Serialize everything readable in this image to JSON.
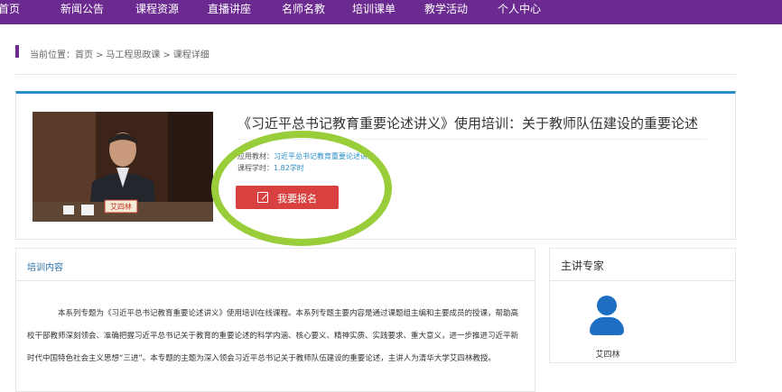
{
  "nav": {
    "items": [
      "首页",
      "新闻公告",
      "课程资源",
      "直播讲座",
      "名师名教",
      "培训课单",
      "教学活动",
      "个人中心"
    ]
  },
  "breadcrumb": {
    "prefix": "当前位置：",
    "items": [
      "首页",
      "马工程思政课",
      "课程详细"
    ],
    "separator": ">"
  },
  "course": {
    "title": "《习近平总书记教育重要论述讲义》使用培训：关于教师队伍建设的重要论述",
    "applied_label": "应用教材：",
    "applied_value": "习近平总书记教育重要论述讲义",
    "hours_label": "课程学时：",
    "hours_value": "1.82学时",
    "enroll_label": "我要报名",
    "video_caption": "艾四林"
  },
  "training": {
    "title": "培训内容",
    "paragraph": "本系列专题为《习近平总书记教育重要论述讲义》使用培训在线课程。本系列专题主要内容是通过课题组主编和主要成员的授课，帮助高校干部教师深刻领会、准确把握习近平总书记关于教育的重要论述的科学内涵、核心要义、精神实质、实践要求、重大意义，进一步推进习近平新时代中国特色社会主义思想“三进”。本专题的主题为深入领会习近平总书记关于教师队伍建设的重要论述，主讲人为清华大学艾四林教授。"
  },
  "expert": {
    "title": "主讲专家",
    "name": "艾四林"
  },
  "colors": {
    "nav_bg": "#6b2a8f",
    "accent_blue": "#2a8fc6",
    "enroll_red": "#d94141",
    "avatar_blue": "#1e6fc4",
    "annotation_green": "#9acd3a"
  }
}
